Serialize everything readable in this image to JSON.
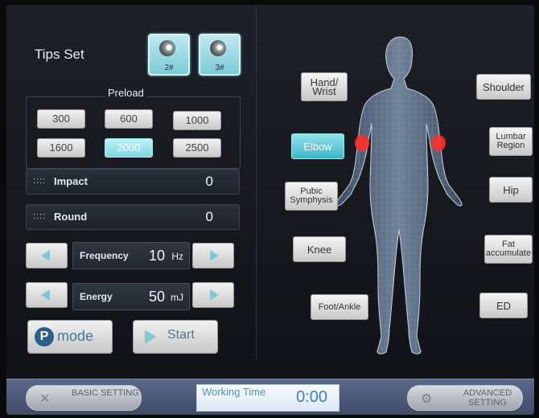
{
  "tips": {
    "title": "Tips Set",
    "items": [
      {
        "label": "2#"
      },
      {
        "label": "3#"
      }
    ]
  },
  "preload": {
    "title": "Preload",
    "options": [
      "300",
      "600",
      "1000",
      "1600",
      "2000",
      "2500"
    ],
    "selected": "2000"
  },
  "counters": {
    "impact": {
      "dots": "::::",
      "label": "Impact",
      "value": "0"
    },
    "round": {
      "dots": "::::",
      "label": "Round",
      "value": "0"
    }
  },
  "params": {
    "frequency": {
      "label": "Frequency",
      "value": "10",
      "unit": "Hz"
    },
    "energy": {
      "label": "Energy",
      "value": "50",
      "unit": "mJ"
    }
  },
  "actions": {
    "mode_icon": "P",
    "mode": "mode",
    "start": "Start"
  },
  "body_regions": {
    "hand_wrist": "Hand/ Wrist",
    "elbow": "Elbow",
    "pubic": "Pubic Symphysis",
    "knee": "Knee",
    "foot_ankle": "Foot/Ankle",
    "shoulder": "Shoulder",
    "lumbar": "Lumbar Region",
    "hip": "Hip",
    "fat": "Fat accumulate",
    "ed": "ED",
    "selected": "Elbow"
  },
  "bottom": {
    "basic": "BASIC SETTING",
    "working_label": "Working Time",
    "working_time": "0:00",
    "advanced": "ADVANCED SETTING"
  },
  "colors": {
    "accent": "#3fb8c8",
    "highlight": "#ff2d2d"
  },
  "icons": [
    "tip-2-icon",
    "tip-3-icon",
    "left-arrow-icon",
    "right-arrow-icon",
    "play-icon",
    "wrench-icon",
    "gear-icon",
    "body-model"
  ]
}
